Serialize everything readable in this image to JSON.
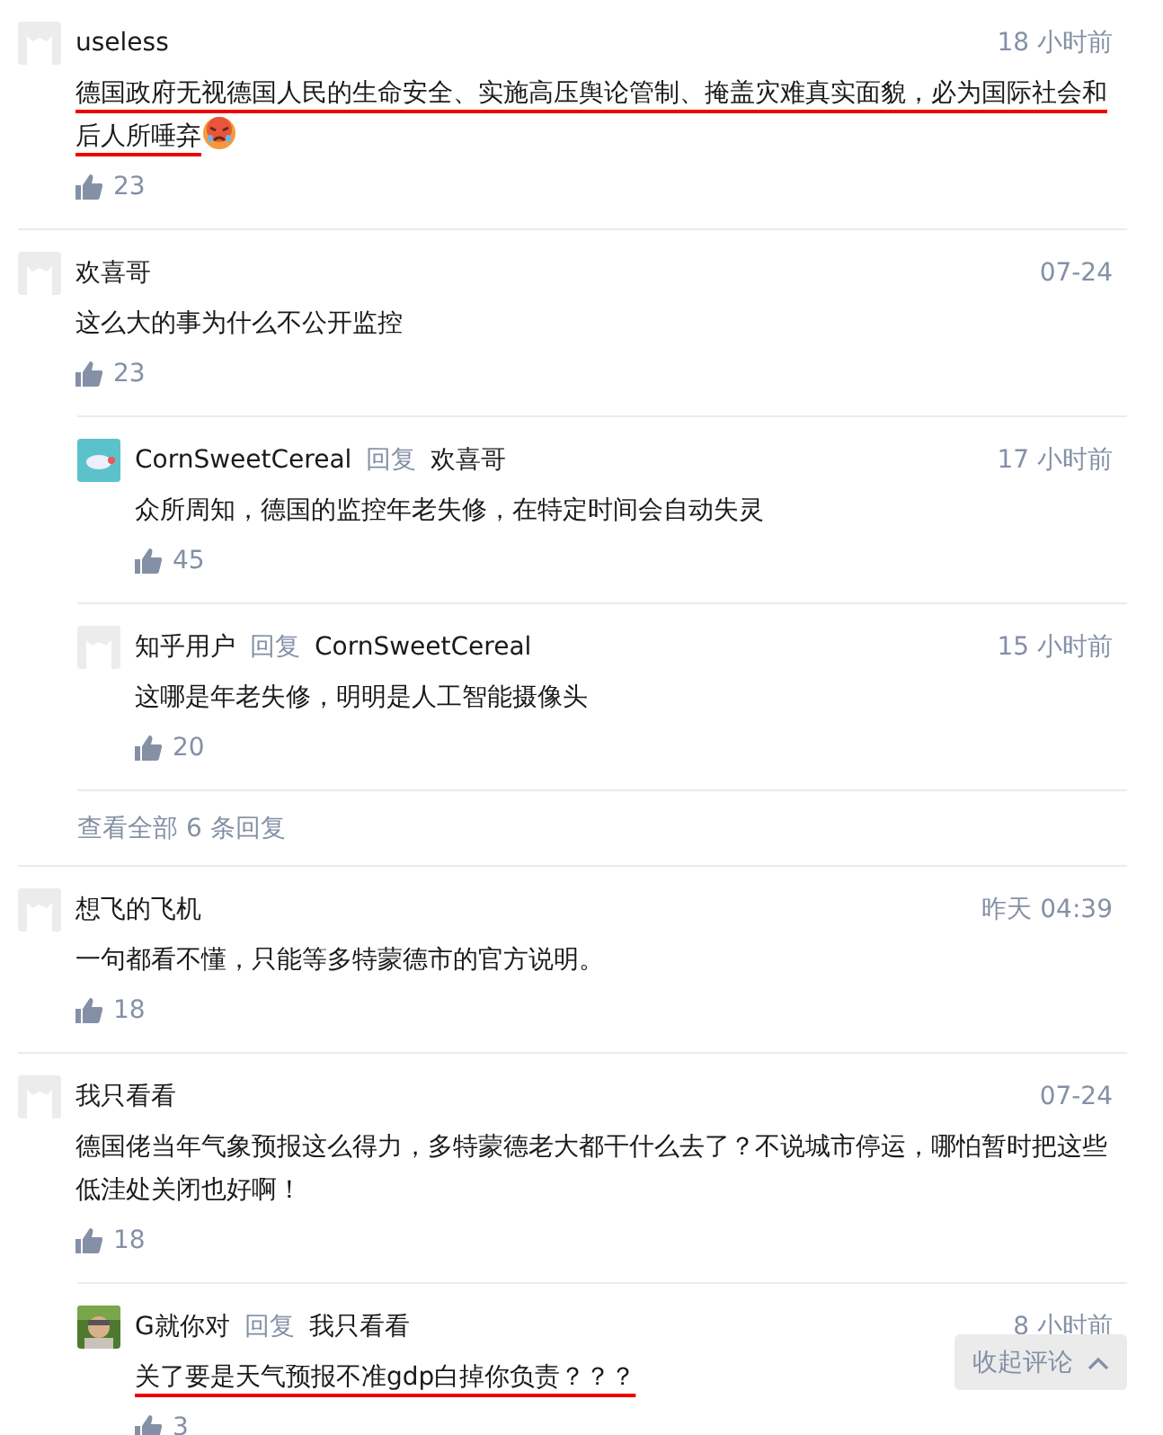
{
  "comments": [
    {
      "author": "useless",
      "avatar": {
        "kind": "default"
      },
      "time": "18 小时前",
      "text": "德国政府无视德国人民的生命安全、实施高压舆论管制、掩盖灾难真实面貌，必为国际社会和后人所唾弃",
      "emoji": true,
      "underlined": true,
      "likes": "23"
    },
    {
      "author": "欢喜哥",
      "avatar": {
        "kind": "default"
      },
      "time": "07-24",
      "text": "这么大的事为什么不公开监控",
      "underlined": false,
      "likes": "23",
      "replies": [
        {
          "author": "CornSweetCereal",
          "avatar": {
            "kind": "teal"
          },
          "reply_label": "回复",
          "reply_to": "欢喜哥",
          "time": "17 小时前",
          "text": "众所周知，德国的监控年老失修，在特定时间会自动失灵",
          "underlined": false,
          "likes": "45"
        },
        {
          "author": "知乎用户",
          "avatar": {
            "kind": "default"
          },
          "reply_label": "回复",
          "reply_to": "CornSweetCereal",
          "time": "15 小时前",
          "text": "这哪是年老失修，明明是人工智能摄像头",
          "underlined": false,
          "likes": "20"
        }
      ],
      "more_replies": "查看全部 6 条回复"
    },
    {
      "author": "想飞的飞机",
      "avatar": {
        "kind": "default"
      },
      "time": "昨天 04:39",
      "text": "一句都看不懂，只能等多特蒙德市的官方说明。",
      "underlined": false,
      "likes": "18"
    },
    {
      "author": "我只看看",
      "avatar": {
        "kind": "default"
      },
      "time": "07-24",
      "text": "德国佬当年气象预报这么得力，多特蒙德老大都干什么去了？不说城市停运，哪怕暂时把这些低洼处关闭也好啊！",
      "underlined": false,
      "likes": "18",
      "replies": [
        {
          "author": "G就你对",
          "reply_label": "回复",
          "reply_to": "我只看看",
          "time": "8 小时前",
          "text": "关了要是天气预报不准gdp白掉你负责？？？",
          "underlined": true,
          "likes": "3"
        }
      ]
    }
  ],
  "collapse_button": "收起评论"
}
